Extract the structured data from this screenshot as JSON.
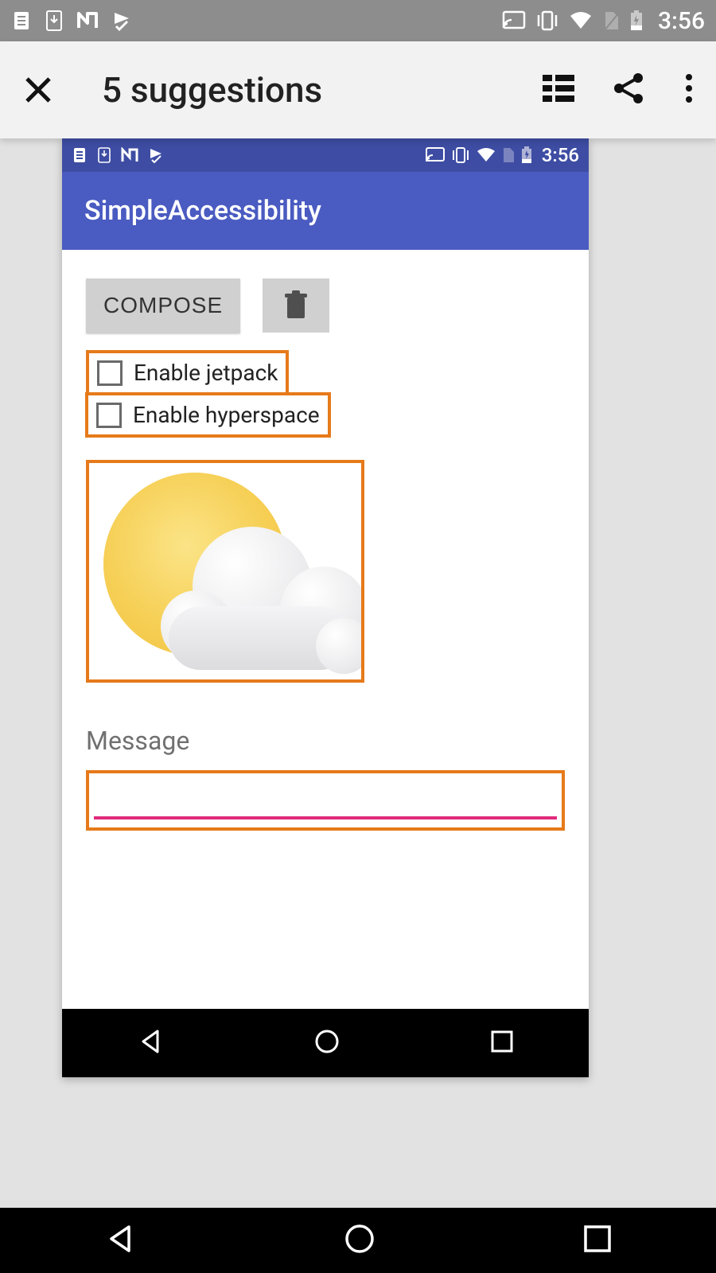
{
  "outer": {
    "status_time": "3:56",
    "title": "5 suggestions"
  },
  "inner": {
    "status_time": "3:56",
    "app_title": "SimpleAccessibility",
    "compose_label": "COMPOSE",
    "checkbox1_label": "Enable jetpack",
    "checkbox2_label": "Enable hyperspace",
    "message_label": "Message",
    "message_value": ""
  },
  "colors": {
    "highlight": "#e67a1a",
    "inner_primary": "#4a5bc1",
    "inner_primary_dark": "#3e4da3",
    "accent_line": "#e02b7b"
  }
}
